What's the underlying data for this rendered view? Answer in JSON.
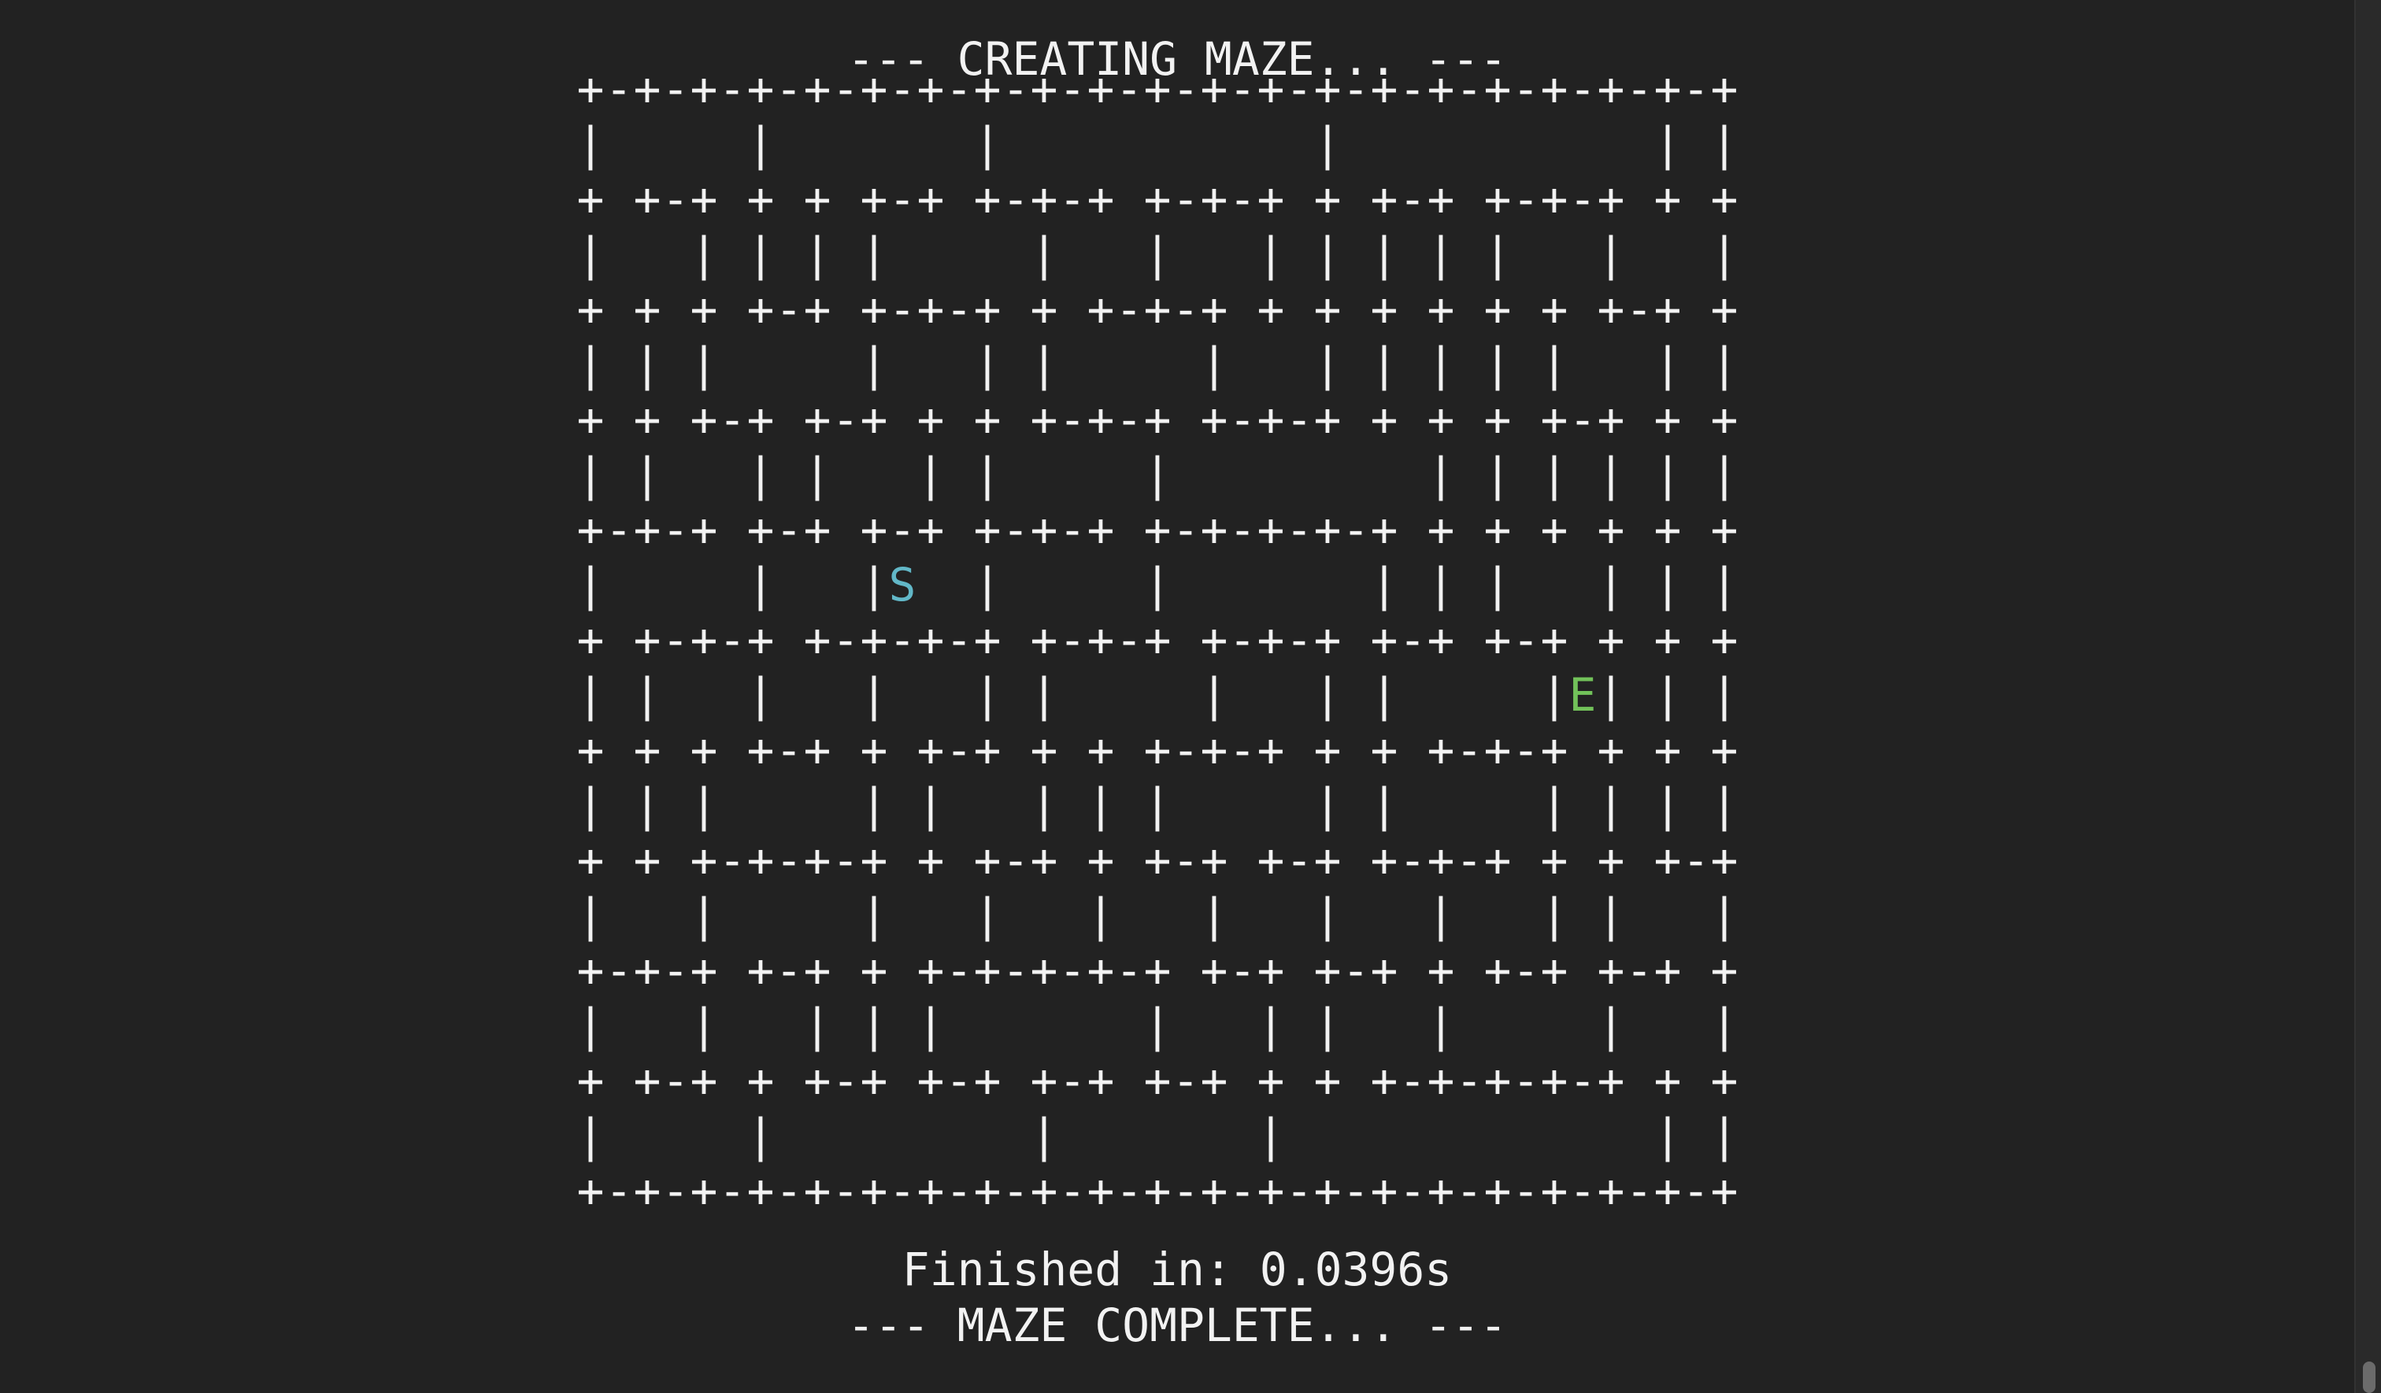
{
  "terminal": {
    "header": "--- CREATING MAZE... ---",
    "timing": "Finished in: 0.0396s",
    "footer": "--- MAZE COMPLETE... ---"
  },
  "maze": {
    "start_marker": "S",
    "end_marker": "E",
    "start_color": "#62b8c8",
    "end_color": "#72c25a",
    "text_color": "#f2f2f2",
    "background": "#222222",
    "rows": [
      "+-+-+-+-+-+-+-+-+-+-+-+-+-+-+-+-+-+-+-+-+",
      "|     |       |           |           | |",
      "+ +-+ + + +-+ +-+-+ +-+-+ + +-+ +-+-+ + +",
      "|   | | | |     |   |   | | | | |   |   |",
      "+ + + +-+ +-+-+ + +-+-+ + + + + + + +-+ +",
      "| | |     |   | |     |   | | | | |   | |",
      "+ + +-+ +-+ + + +-+-+ +-+-+ + + + +-+ + +",
      "| |   | |   | |     |         | | | | | |",
      "+-+-+ +-+ +-+ +-+-+ +-+-+-+-+ + + + + + +",
      "|     |   |S  |     |       | | |   | | |",
      "+ +-+-+ +-+-+-+ +-+-+ +-+-+ +-+ +-+ + + +",
      "| |   |   |   | |     |   | |     |E| | |",
      "+ + + +-+ + +-+ + + +-+-+ + + +-+-+ + + +",
      "| | |     | |   | | |     | |     | | | |",
      "+ + +-+-+-+ + +-+ + +-+ +-+ +-+-+ + + +-+",
      "|   |     |   |   |   |   |   |   | |   |",
      "+-+-+ +-+ + +-+-+-+-+ +-+ +-+ + +-+ +-+ +",
      "|   |   | | |       |   | |   |     |   |",
      "+ +-+ + +-+ +-+ +-+ +-+ + + +-+-+-+-+ + +",
      "|     |         |       |             | |",
      "+-+-+-+-+-+-+-+-+-+-+-+-+-+-+-+-+-+-+-+-+"
    ]
  }
}
